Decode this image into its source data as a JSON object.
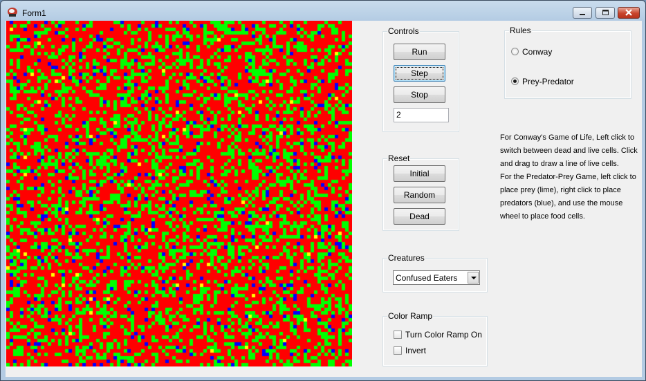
{
  "window": {
    "title": "Form1",
    "icon": "app-icon"
  },
  "grid": {
    "dead_color": "#ff0000",
    "prey_color": "#00ff00",
    "predator_color": "#0000ff",
    "food_color": "#ffff00"
  },
  "controls": {
    "legend": "Controls",
    "run": "Run",
    "step": "Step",
    "stop": "Stop",
    "speed_value": "2"
  },
  "reset": {
    "legend": "Reset",
    "initial": "Initial",
    "random": "Random",
    "dead": "Dead"
  },
  "creatures": {
    "legend": "Creatures",
    "selected": "Confused Eaters"
  },
  "color_ramp": {
    "legend": "Color Ramp",
    "turn_on": "Turn Color Ramp On",
    "invert": "Invert"
  },
  "rules": {
    "legend": "Rules",
    "conway": "Conway",
    "prey_predator": "Prey-Predator",
    "selected": "prey_predator"
  },
  "help": {
    "conway_text": "For Conway's Game of Life, Left click to switch between dead and live cells. Click and drag to draw a line of live cells.",
    "predator_text": "For the Predator-Prey Game, left click to place prey (lime), right click to place predators (blue), and use the mouse wheel to place food cells."
  }
}
